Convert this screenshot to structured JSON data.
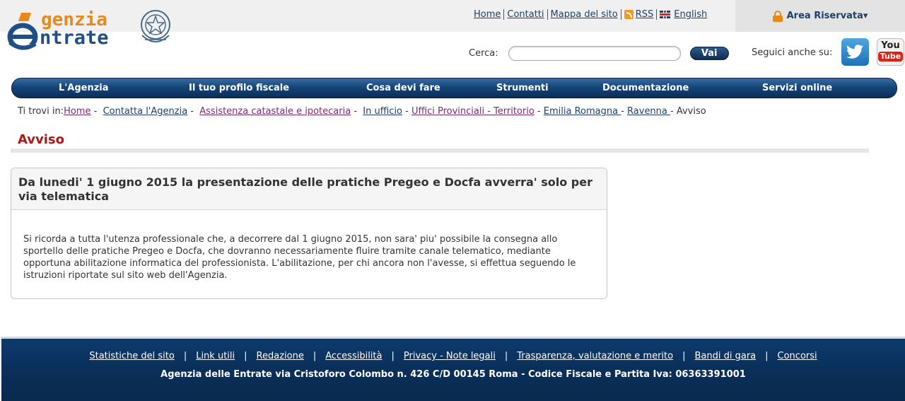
{
  "header": {
    "logo_top": "genzia",
    "logo_bottom": "ntrate",
    "top_links": [
      {
        "label": "Home"
      },
      {
        "label": "Contatti"
      },
      {
        "label": "Mappa del sito"
      },
      {
        "label": "RSS"
      },
      {
        "label": "English"
      }
    ],
    "area_riservata": "Area Riservata▾",
    "search_label": "Cerca:",
    "search_value": "",
    "search_button": "Vai",
    "follow_label": "Seguici anche su:",
    "youtube_top": "You",
    "youtube_bottom": "Tube"
  },
  "nav": {
    "items": [
      {
        "label": "L'Agenzia"
      },
      {
        "label": "Il tuo profilo fiscale"
      },
      {
        "label": "Cosa devi fare"
      },
      {
        "label": "Strumenti"
      },
      {
        "label": "Documentazione"
      },
      {
        "label": "Servizi online"
      }
    ]
  },
  "breadcrumb": {
    "prefix": "Ti trovi in:",
    "items": [
      {
        "label": "Home"
      },
      {
        "label": "Contatta l'Agenzia"
      },
      {
        "label": "Assistenza catastale e ipotecaria"
      },
      {
        "label": "In ufficio"
      },
      {
        "label": "Uffici Provinciali - Territorio"
      },
      {
        "label": "Emilia Romagna "
      },
      {
        "label": "Ravenna "
      }
    ],
    "current": "Avviso"
  },
  "page": {
    "title": "Avviso"
  },
  "notice": {
    "title": "Da lunedi' 1 giugno 2015 la presentazione delle pratiche Pregeo e Docfa avverra' solo per via telematica",
    "body": "Si ricorda a tutta l'utenza professionale che, a decorrere dal 1 giugno 2015, non sara' piu' possibile la consegna allo sportello delle pratiche Pregeo e Docfa, che dovranno necessariamente fluire tramite canale telematico, mediante opportuna abilitazione informatica del professionista. L'abilitazione, per chi ancora non l'avesse, si effettua seguendo le istruzioni riportate sul sito web dell'Agenzia."
  },
  "footer": {
    "links": [
      {
        "label": "Statistiche del sito"
      },
      {
        "label": "Link utili"
      },
      {
        "label": "Redazione"
      },
      {
        "label": "Accessibilità"
      },
      {
        "label": "Privacy - Note legali"
      },
      {
        "label": "Trasparenza, valutazione e merito"
      },
      {
        "label": "Bandi di gara"
      },
      {
        "label": "Concorsi"
      }
    ],
    "separator": "|",
    "address": "Agenzia delle Entrate via Cristoforo Colombo n. 426 C/D 00145 Roma - Codice Fiscale e Partita Iva: 06363391001"
  },
  "colors": {
    "brand_blue": "#1f4f86",
    "brand_orange": "#e8891a",
    "title_red": "#b01818",
    "nav_dark": "#0b2e58"
  }
}
